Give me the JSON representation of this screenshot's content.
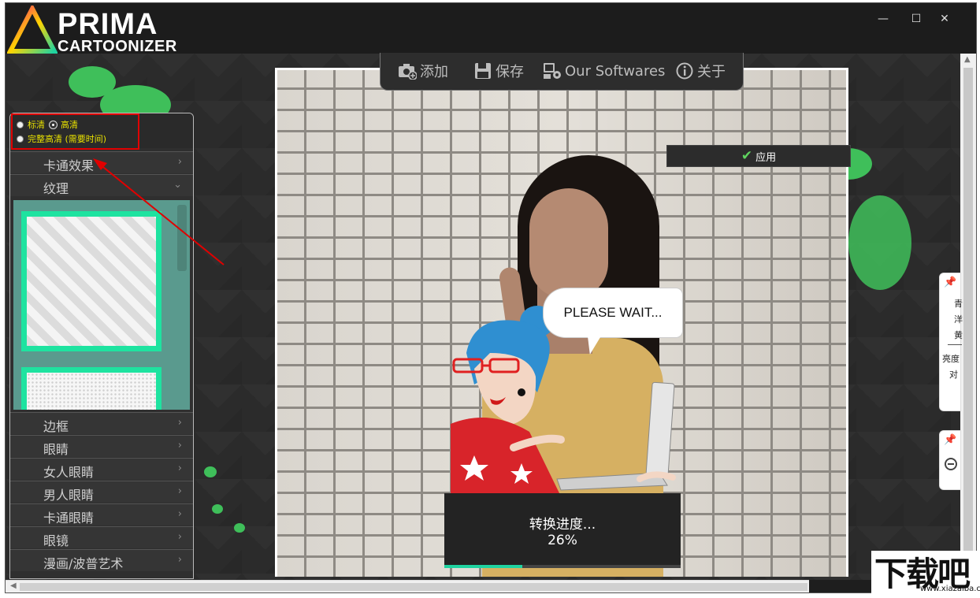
{
  "app": {
    "logo_line1": "PRIMA",
    "logo_line2": "CARTOONIZER",
    "window_controls": {
      "minimize": "—",
      "maximize": "☐",
      "close": "✕"
    }
  },
  "toolbar": {
    "add_label": "添加",
    "save_label": "保存",
    "software_label": "Our Softwares",
    "about_label": "关于"
  },
  "quality": {
    "options": [
      {
        "label": "标清",
        "selected": false
      },
      {
        "label": "高清",
        "selected": true
      },
      {
        "label": "完整高清 (需要时间)",
        "selected": false
      }
    ]
  },
  "sidebar": {
    "items": [
      {
        "label": "卡通效果",
        "state": "collapsed"
      },
      {
        "label": "纹理",
        "state": "expanded"
      },
      {
        "label": "边框",
        "state": "collapsed"
      },
      {
        "label": "眼睛",
        "state": "collapsed"
      },
      {
        "label": "女人眼睛",
        "state": "collapsed"
      },
      {
        "label": "男人眼睛",
        "state": "collapsed"
      },
      {
        "label": "卡通眼睛",
        "state": "collapsed"
      },
      {
        "label": "眼镜",
        "state": "collapsed"
      },
      {
        "label": "漫画/波普艺术",
        "state": "collapsed"
      }
    ]
  },
  "apply": {
    "label": "应用"
  },
  "bubble": {
    "text": "PLEASE WAIT..."
  },
  "progress": {
    "label": "转换进度...",
    "percent_text": "26%",
    "value": 0.33
  },
  "right_panel": {
    "lines": [
      "青",
      "洋",
      "黄",
      "亮度",
      "对"
    ]
  },
  "watermark": {
    "text": "下载吧",
    "url_text": "www.xiazaiba.com"
  },
  "colors": {
    "accent": "#1fd3a0",
    "highlight": "#e00000",
    "splash": "#3fbf5a",
    "radio_text": "#e8e000"
  }
}
